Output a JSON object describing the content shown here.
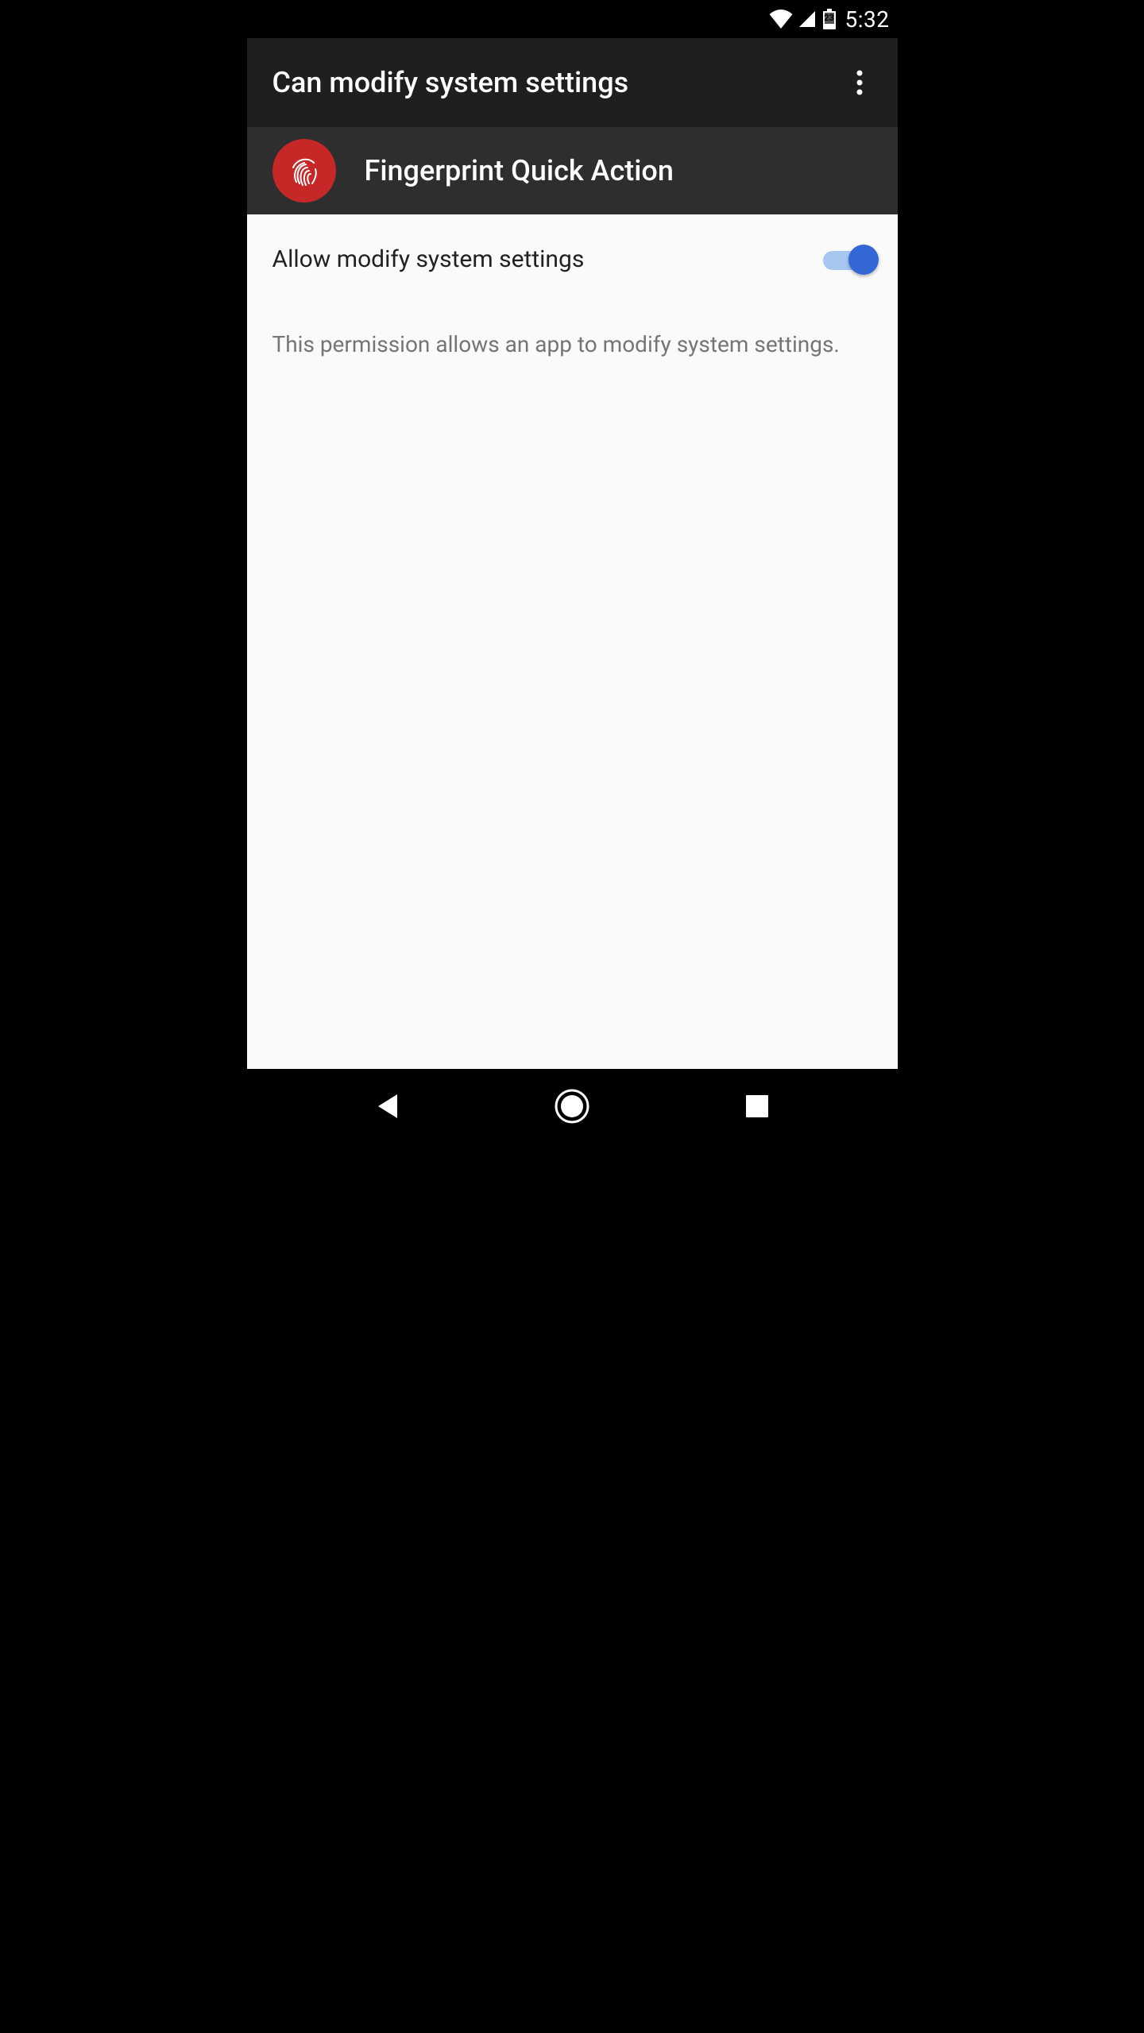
{
  "status": {
    "battery_level": "23",
    "time": "5:32"
  },
  "appbar": {
    "title": "Can modify system settings"
  },
  "app": {
    "name": "Fingerprint Quick Action",
    "icon_color": "#c62828"
  },
  "setting": {
    "label": "Allow modify system settings",
    "enabled": true
  },
  "description": "This permission allows an app to modify system settings."
}
